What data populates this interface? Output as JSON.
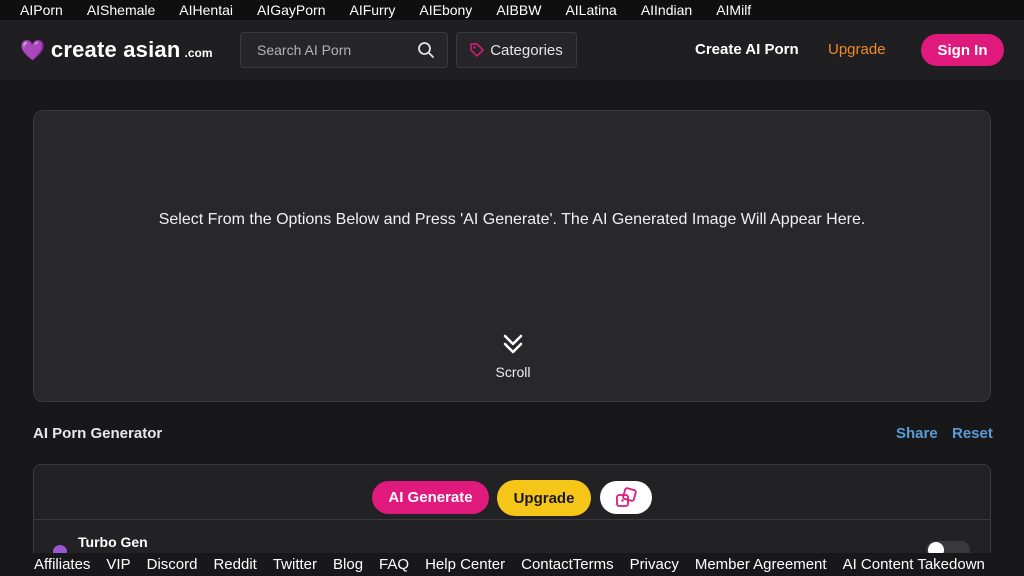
{
  "top_nav": [
    "AIPorn",
    "AIShemale",
    "AIHentai",
    "AIGayPorn",
    "AIFurry",
    "AIEbony",
    "AIBBW",
    "AILatina",
    "AIIndian",
    "AIMilf"
  ],
  "header": {
    "logo_name": "create asian",
    "logo_suffix": ".com",
    "search_placeholder": "Search AI Porn",
    "categories_label": "Categories",
    "create_link": "Create AI Porn",
    "upgrade_link": "Upgrade",
    "signin_label": "Sign In"
  },
  "canvas": {
    "message": "Select From the Options Below and Press 'AI Generate'. The AI Generated Image Will Appear Here.",
    "scroll_label": "Scroll"
  },
  "generator": {
    "title": "AI Porn Generator",
    "share_label": "Share",
    "reset_label": "Reset",
    "generate_label": "AI Generate",
    "upgrade_label": "Upgrade",
    "turbo_label": "Turbo Gen",
    "turbo_enabled": false
  },
  "footer": [
    "Affiliates",
    "VIP",
    "Discord",
    "Reddit",
    "Twitter",
    "Blog",
    "FAQ",
    "Help Center",
    "ContactTerms",
    "Privacy",
    "Member Agreement",
    "AI Content Takedown"
  ],
  "colors": {
    "accent_pink": "#e0197d",
    "accent_yellow": "#f5c518",
    "accent_orange": "#f08a24",
    "link_blue": "#5b9bd5",
    "brand_purple": "#b05ad8"
  },
  "icons": [
    "heart-icon",
    "search-icon",
    "tag-icon",
    "chevron-double-down-icon",
    "dice-icon",
    "sparkle-icon"
  ]
}
